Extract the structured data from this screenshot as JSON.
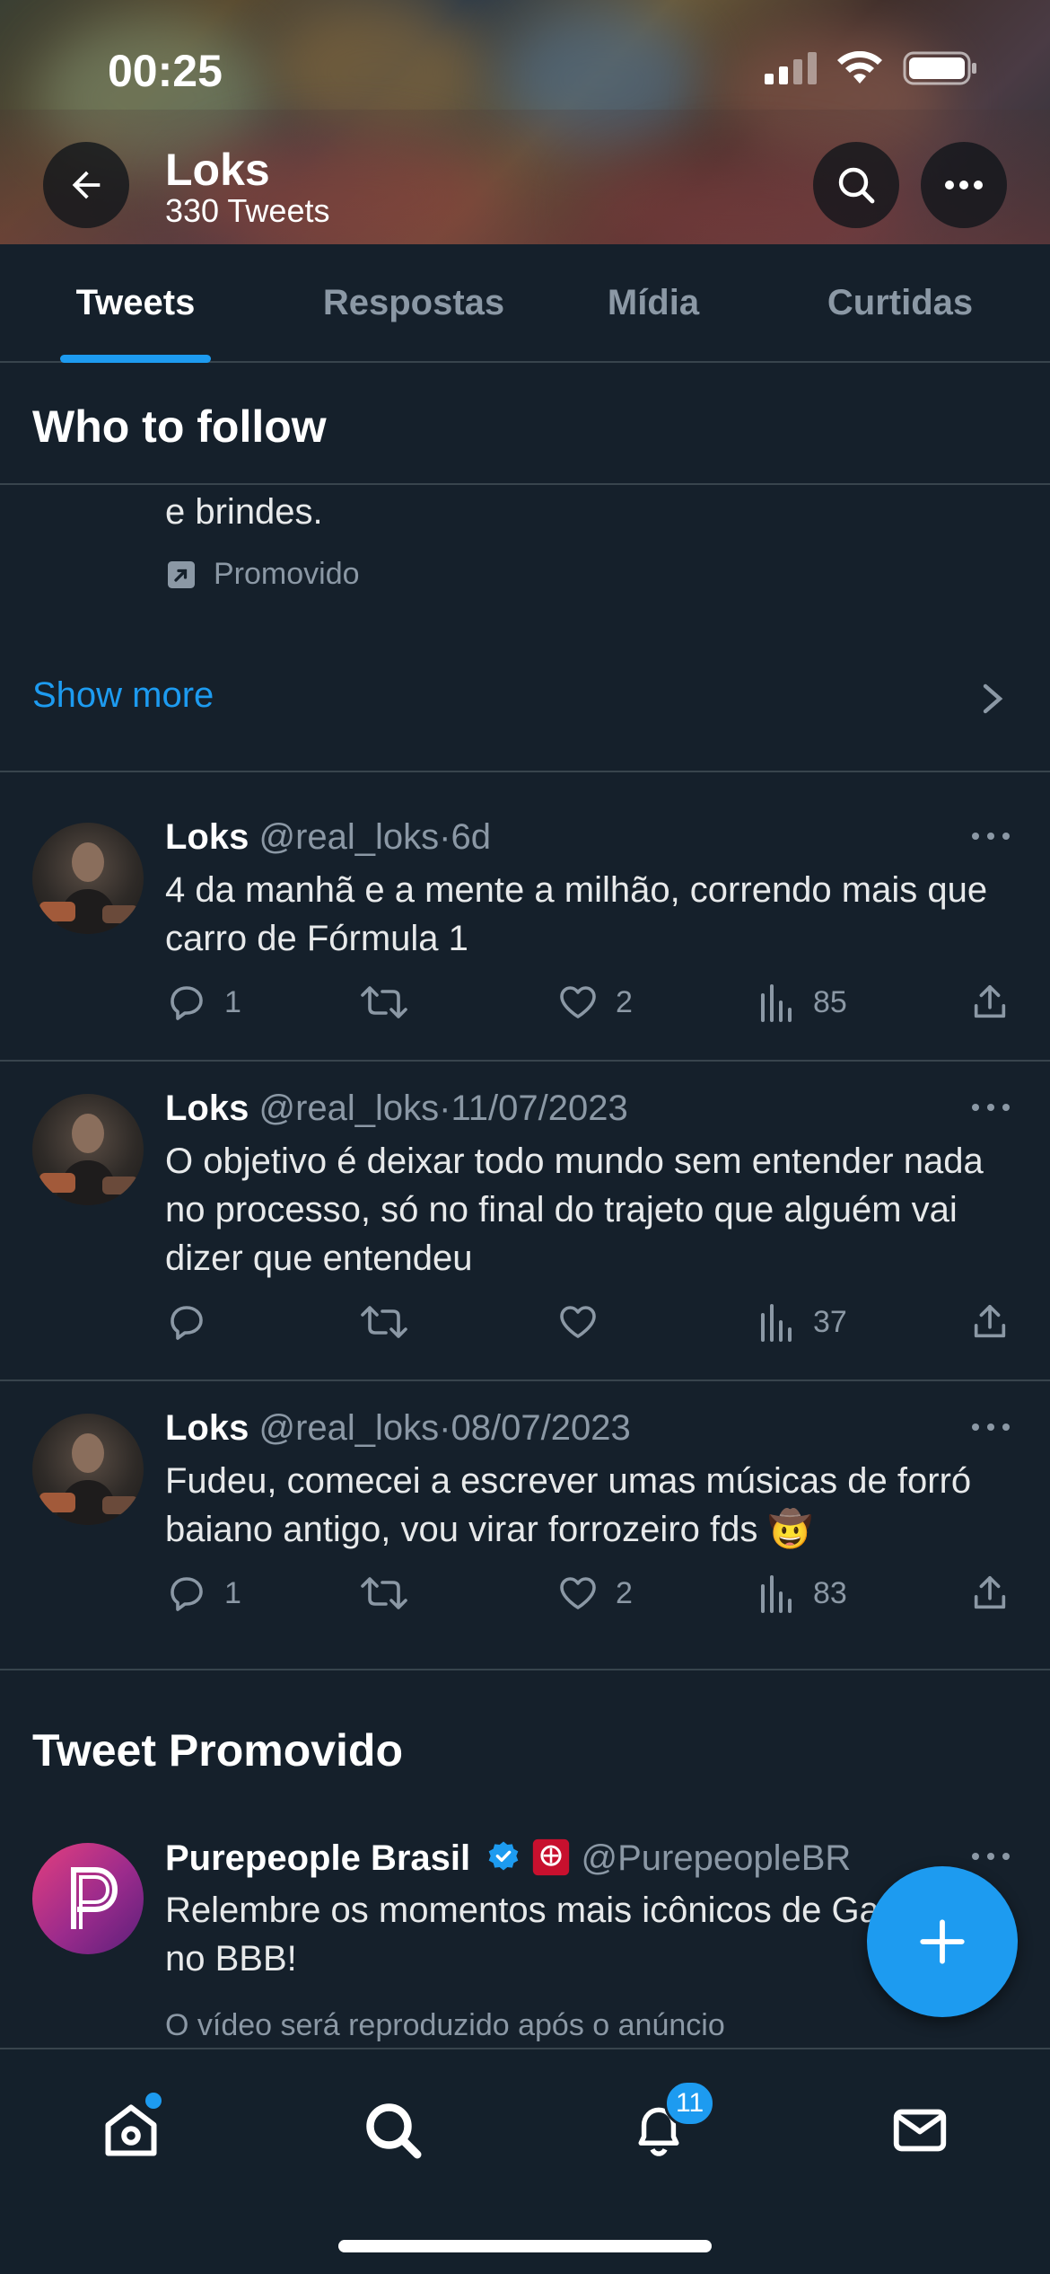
{
  "status_bar": {
    "time": "00:25"
  },
  "header": {
    "name": "Loks",
    "tweet_count": "330 Tweets"
  },
  "tabs": [
    {
      "label": "Tweets",
      "active": true
    },
    {
      "label": "Respostas",
      "active": false
    },
    {
      "label": "Mídia",
      "active": false
    },
    {
      "label": "Curtidas",
      "active": false
    }
  ],
  "who_to_follow": {
    "title": "Who to follow",
    "partial_text": "e brindes.",
    "promoted_label": "Promovido",
    "show_more": "Show more"
  },
  "tweets": [
    {
      "name": "Loks",
      "handle": "@real_loks",
      "separator": "·",
      "date": "6d",
      "text": "4 da manhã e a mente a milhão, correndo mais que carro de Fórmula 1",
      "replies": "1",
      "retweets": "",
      "likes": "2",
      "views": "85"
    },
    {
      "name": "Loks",
      "handle": "@real_loks",
      "separator": "·",
      "date": "11/07/2023",
      "text": "O objetivo é deixar todo mundo sem entender nada no processo, só no final do trajeto que alguém vai dizer que entendeu",
      "replies": "",
      "retweets": "",
      "likes": "",
      "views": "37"
    },
    {
      "name": "Loks",
      "handle": "@real_loks",
      "separator": "·",
      "date": "08/07/2023",
      "text": "Fudeu, comecei a escrever umas músicas de forró baiano antigo, vou virar forrozeiro fds 🤠",
      "replies": "1",
      "retweets": "",
      "likes": "2",
      "views": "83"
    }
  ],
  "promoted_tweet": {
    "section_title": "Tweet Promovido",
    "name": "Purepeople Brasil",
    "handle": "@PurepeopleBR",
    "text": "Relembre os momentos mais icônicos de Gavassi no BBB!",
    "caption": "O vídeo será reproduzido após o anúncio"
  },
  "bottom_nav": {
    "notifications_badge": "11"
  },
  "colors": {
    "background": "#15202b",
    "accent": "#1d9bf0",
    "divider": "#38444d",
    "muted": "#8b98a5"
  }
}
